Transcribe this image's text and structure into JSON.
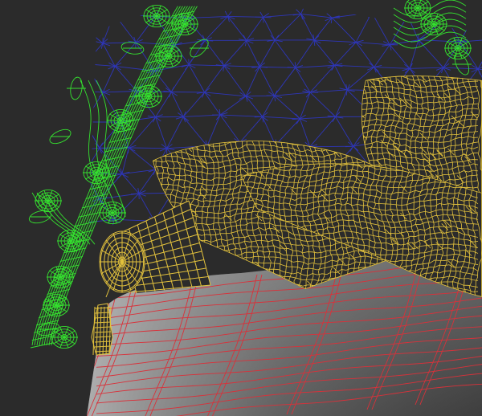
{
  "scene": {
    "background_color": "#2b2b2b",
    "wire_colors": {
      "frame": "#35e22f",
      "headboard": "#2e36b8",
      "pillows": "#e3c23d",
      "mattress": "#d9313a"
    },
    "objects": [
      {
        "name": "frame-wireframe"
      },
      {
        "name": "headboard-wireframe"
      },
      {
        "name": "pillows-wireframe"
      },
      {
        "name": "bolster-wireframe"
      },
      {
        "name": "tassel-wireframe"
      },
      {
        "name": "mattress-shaded"
      }
    ]
  }
}
